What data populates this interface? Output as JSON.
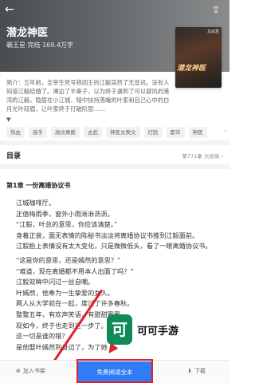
{
  "header": {
    "back_icon": "←",
    "share_icon": "⇪",
    "title": "潜龙神医",
    "meta": "霸王星·完结·169.4万字",
    "cover_title": "潜龙神医",
    "cover_sub": "龙咸君"
  },
  "intro": {
    "text": "简介：五年前，圭宰生死号称阎王的江毅突然了无音讯。没有人知道江毅结婚了。潭边了半辈子，以为终于遇到了可以避风的港湾的江毅，隐居在小江城，暗中扶持落魄的叶家和自己心中的白月光叶轻眉，让叶家终于打破阶层……",
    "more": "▼"
  },
  "tags": [
    "热血",
    "高手",
    "高纹果断",
    "古武",
    "神医文爽文",
    "打脸",
    "都市",
    "神医"
  ],
  "tags_more": "›",
  "catalog": {
    "title": "目录",
    "status": "第771章 大结局 ›"
  },
  "chapter": {
    "title": "第1章 一份离婚协议书",
    "lines": [
      "江城咖啡厅。",
      "正值梅雨季，窗外小雨淅淅沥沥。",
      "“江毅，叶总的意思，你应该清楚。”",
      "身着正装，面无表情的陈秘书淡淡将离婚协议书推到江毅面前。",
      "江毅脸上表情没有太大变化，只是微微低头，看了一眼离婚协议书。",
      "",
      "“这是你的意思，还是嫣然的意思？”",
      "“难道，现在离婚都不用本人出面了吗？”",
      "江毅双眸中闪过一丝自嘲。",
      "叶嫣然，他奉为一生挚爱的女人。",
      "两人从大学就在一起，度过了许多春秋。",
      "整整五年，有欢声笑语，有甜甜蜜蜜。",
      "现如今，终于也走到这一步了。",
      "这一切是谁的错？",
      "是他娶叶嫣然到身边了，为了她"
    ]
  },
  "bottom": {
    "add_shelf_icon": "⊕",
    "add_shelf": "加入书架",
    "free_read": "免费阅读全本",
    "download_icon": "⬇",
    "download": "下载"
  },
  "watermark": {
    "logo": "可",
    "text": "可可手游"
  },
  "colors": {
    "accent": "#2f7cf6",
    "highlight": "#e0202a",
    "watermark_green": "#0f8a58"
  }
}
